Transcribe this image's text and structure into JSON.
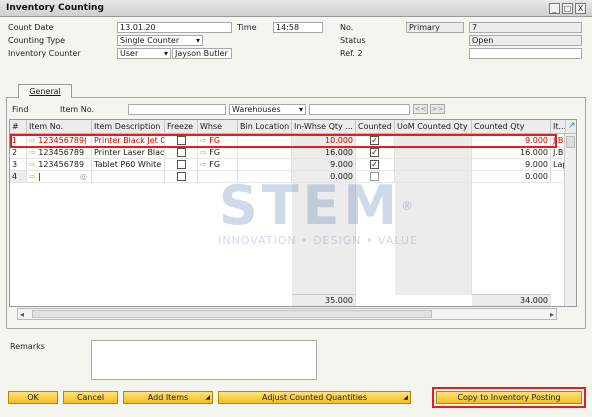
{
  "window": {
    "title": "Inventory Counting",
    "buttons": [
      "_",
      "□",
      "X"
    ]
  },
  "header": {
    "count_date_label": "Count Date",
    "count_date": "13.01.20",
    "time_label": "Time",
    "time": "14:58",
    "counting_type_label": "Counting Type",
    "counting_type": "Single Counter",
    "inventory_counter_label": "Inventory Counter",
    "counter_type": "User",
    "counter_name": "Jayson Butler",
    "no_label": "No.",
    "series": "Primary",
    "no": "7",
    "status_label": "Status",
    "status": "Open",
    "ref2_label": "Ref. 2",
    "ref2": ""
  },
  "tabs": {
    "general": "General"
  },
  "find": {
    "find_label": "Find",
    "item_no_label": "Item No.",
    "warehouses": "Warehouses",
    "prev": "<<",
    "next": ">>"
  },
  "grid": {
    "headers": [
      "#",
      "Item No.",
      "Item Description",
      "Freeze",
      "Whse",
      "Bin Location",
      "In-Whse Qty ...",
      "Counted",
      "UoM Counted Qty",
      "Counted Qty",
      "It..."
    ],
    "rows": [
      {
        "num": "1",
        "item_no": "123456789(",
        "desc": "Printer Black Jet 01",
        "freeze": false,
        "whse": "FG",
        "bin": "",
        "in_whse": "10.000",
        "counted": true,
        "uom": "",
        "counted_qty": "9.000",
        "it": "J.B. P"
      },
      {
        "num": "2",
        "item_no": "123456789",
        "desc": "Printer Laser Black (",
        "freeze": false,
        "whse": "FG",
        "bin": "",
        "in_whse": "16.000",
        "counted": true,
        "uom": "",
        "counted_qty": "16.000",
        "it": "J.B. P"
      },
      {
        "num": "3",
        "item_no": "123456789",
        "desc": "Tablet P60 White",
        "freeze": false,
        "whse": "FG",
        "bin": "",
        "in_whse": "9.000",
        "counted": true,
        "uom": "",
        "counted_qty": "9.000",
        "it": "Lapto"
      },
      {
        "num": "4",
        "item_no": "",
        "desc": "",
        "freeze": false,
        "whse": "",
        "bin": "",
        "in_whse": "0.000",
        "counted": false,
        "uom": "",
        "counted_qty": "0.000",
        "it": ""
      }
    ],
    "total_in_whse": "35.000",
    "total_counted": "34.000"
  },
  "remarks_label": "Remarks",
  "watermark": {
    "brand": "STEM",
    "tagline": "INNOVATION • DESIGN • VALUE",
    "reg": "®"
  },
  "footer": {
    "ok": "OK",
    "cancel": "Cancel",
    "add_items": "Add Items",
    "adjust": "Adjust Counted Quantities",
    "copy": "Copy to Inventory Posting"
  },
  "colors": {
    "highlight": "#e02020",
    "button": "#f3be20",
    "error_text": "#d00000"
  },
  "icons": {
    "link_arrow": "arrow-right-icon",
    "expand": "expand-arrow-icon"
  }
}
